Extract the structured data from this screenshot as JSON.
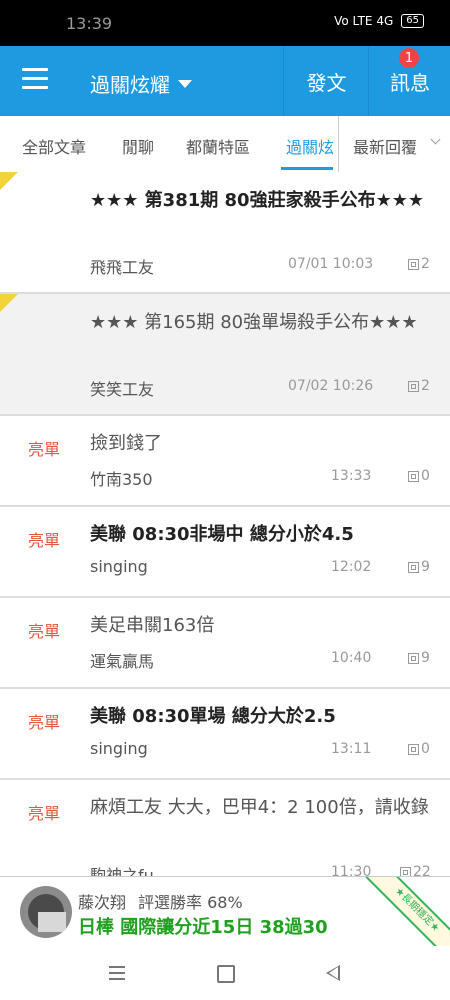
{
  "status": {
    "time": "13:39",
    "signal": "Vo LTE 4G",
    "battery": "65"
  },
  "appbar": {
    "title": "過關炫耀",
    "post_label": "發文",
    "message_label": "訊息",
    "message_badge": "1"
  },
  "tabs": [
    {
      "label": "全部文章"
    },
    {
      "label": "閒聊"
    },
    {
      "label": "都蘭特區"
    },
    {
      "label": "過關炫耀"
    }
  ],
  "sort": {
    "label": "最新回覆"
  },
  "posts": [
    {
      "tag": "",
      "title": "★★★ 第381期 80強莊家殺手公布★★★",
      "author": "飛飛工友",
      "time": "07/01 10:03",
      "replies": "2",
      "bold": true,
      "pinned": true
    },
    {
      "tag": "",
      "title": "★★★ 第165期 80強單場殺手公布★★★",
      "author": "笑笑工友",
      "time": "07/02 10:26",
      "replies": "2",
      "bold": false,
      "pinned": true
    },
    {
      "tag": "亮單",
      "title": "撿到錢了",
      "author": "竹南350",
      "time": "13:33",
      "replies": "0",
      "bold": false
    },
    {
      "tag": "亮單",
      "title": "美聯 08:30非場中 總分小於4.5",
      "author": "singing",
      "time": "12:02",
      "replies": "9",
      "bold": true
    },
    {
      "tag": "亮單",
      "title": "美足串關163倍",
      "author": "運氣贏馬",
      "time": "10:40",
      "replies": "9",
      "bold": false
    },
    {
      "tag": "亮單",
      "title": "美聯 08:30單場 總分大於2.5",
      "author": "singing",
      "time": "13:11",
      "replies": "0",
      "bold": true
    },
    {
      "tag": "亮單",
      "title": "麻煩工友 大大，巴甲4：2 100倍，請收錄",
      "author": "駒神之fu",
      "time": "11:30",
      "replies": "22",
      "bold": false
    }
  ],
  "expert": {
    "name": "藤次翔",
    "rate": "評選勝率 68%",
    "pick": "日棒 國際讓分近15日 38過30",
    "ribbon": "★長期穩定★"
  },
  "colors": {
    "accent": "#1e9be0",
    "tag": "#e05a3a",
    "pick": "#1fa01f"
  }
}
